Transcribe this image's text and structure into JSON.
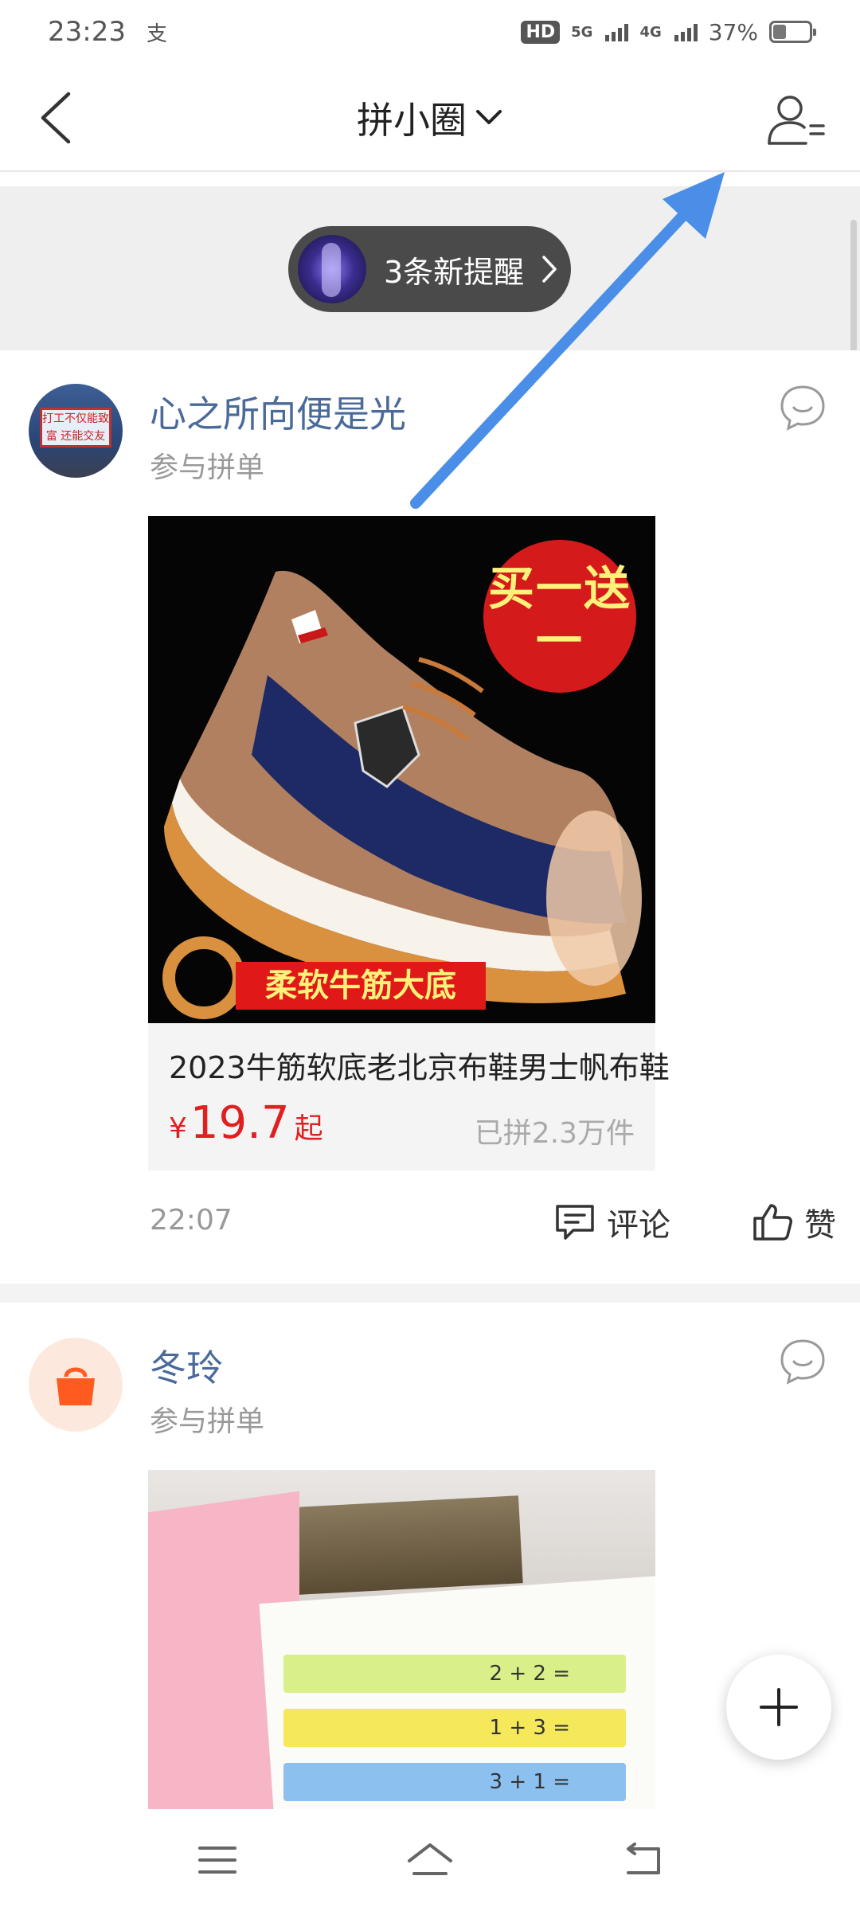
{
  "status_bar": {
    "time": "23:23",
    "alipay_glyph": "支",
    "hd_label": "HD",
    "net_1": "5G",
    "net_2": "4G",
    "battery": "37%",
    "battery_level": 0.37
  },
  "header": {
    "title": "拼小圈",
    "back_icon": "chevron-left-icon",
    "profile_icon": "user-list-icon",
    "title_dropdown_icon": "chevron-down-icon"
  },
  "reminder": {
    "label": "3条新提醒"
  },
  "posts": [
    {
      "username": "心之所向便是光",
      "subtext": "参与拼单",
      "avatar_text": "打工不仅能致富 还能交友娶媳妇",
      "product": {
        "title": "2023牛筋软底老北京布鞋男士帆布鞋",
        "price_symbol": "¥",
        "price": "19.7",
        "price_suffix": "起",
        "sold": "已拼2.3万件",
        "promo_circle": "买一送一",
        "promo_banner": "柔软牛筋大底"
      },
      "time": "22:07",
      "comment_label": "评论",
      "like_label": "赞"
    },
    {
      "username": "冬玲",
      "subtext": "参与拼单",
      "book_rows": [
        "2 + 2 =",
        "1 + 3 =",
        "3 + 1 ="
      ]
    }
  ],
  "colors": {
    "accent_red": "#e02020",
    "username_blue": "#4a6a9a",
    "annotation_blue": "#4a8ee8",
    "avatar_orange": "#ff5a1f"
  }
}
